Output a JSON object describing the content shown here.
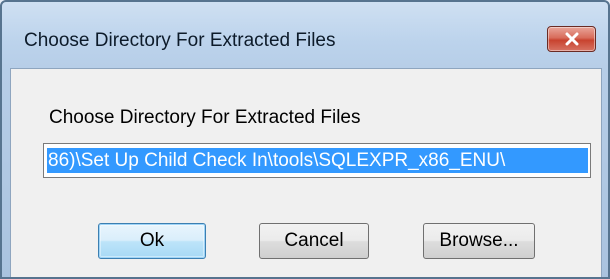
{
  "window": {
    "title": "Choose Directory For Extracted Files",
    "close_glyph": "✕"
  },
  "dialog": {
    "prompt": "Choose Directory For Extracted Files",
    "path_value": "86)\\Set Up Child Check In\\tools\\SQLEXPR_x86_ENU\\"
  },
  "buttons": {
    "ok": "Ok",
    "cancel": "Cancel",
    "browse": "Browse..."
  },
  "icons": {
    "close": "close-icon"
  },
  "colors": {
    "selection_background": "#3399ff",
    "selection_text": "#ffffff",
    "close_button": "#c8432f",
    "default_button_border": "#3c7fb1"
  }
}
